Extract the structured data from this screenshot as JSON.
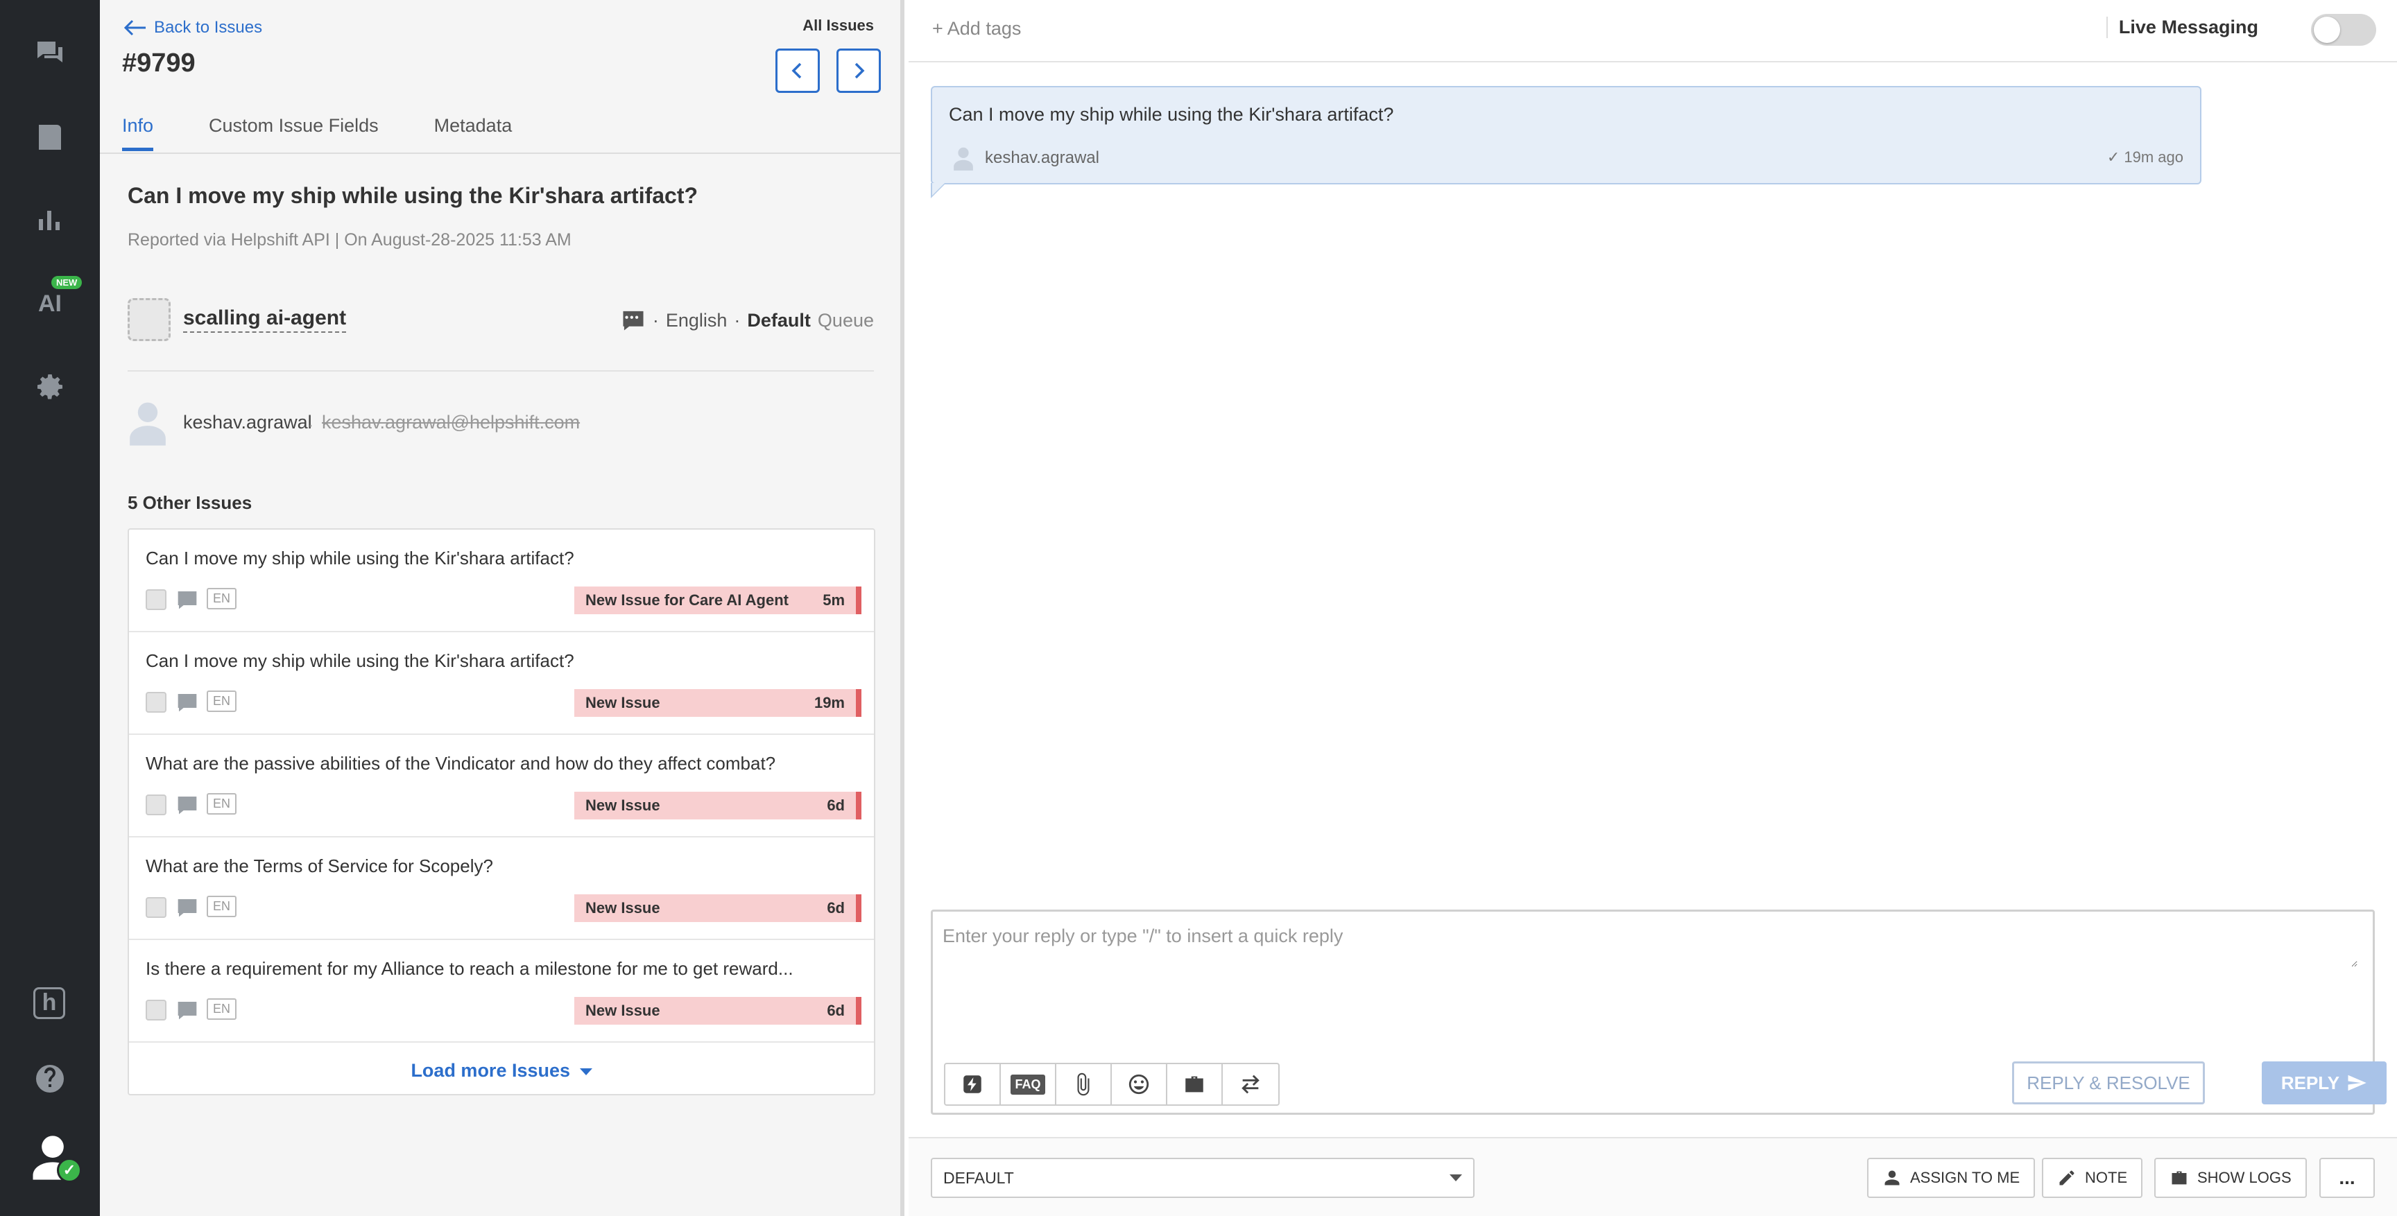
{
  "nav": {
    "ai_label": "AI",
    "new_badge": "NEW",
    "h_label": "h"
  },
  "issue": {
    "back_label": "Back to Issues",
    "all_issues": "All Issues",
    "number": "#9799",
    "tabs": [
      "Info",
      "Custom Issue Fields",
      "Metadata"
    ],
    "subject": "Can I move my ship while using the Kir'shara artifact?",
    "reported": "Reported via Helpshift API | On August-28-2025 11:53 AM",
    "app_name": "scalling ai-agent",
    "language": "English",
    "queue_name": "Default",
    "queue_label": "Queue",
    "user_name": "keshav.agrawal",
    "user_email": "keshav.agrawal@helpshift.com"
  },
  "other_issues": {
    "title": "5 Other Issues",
    "load_more": "Load more Issues",
    "items": [
      {
        "text": "Can I move my ship while using the Kir'shara artifact?",
        "lang": "EN",
        "status": "New Issue for Care AI Agent",
        "age": "5m"
      },
      {
        "text": "Can I move my ship while using the Kir'shara artifact?",
        "lang": "EN",
        "status": "New Issue",
        "age": "19m"
      },
      {
        "text": "What are the passive abilities of the Vindicator and how do they affect combat?",
        "lang": "EN",
        "status": "New Issue",
        "age": "6d"
      },
      {
        "text": "What are the Terms of Service for Scopely?",
        "lang": "EN",
        "status": "New Issue",
        "age": "6d"
      },
      {
        "text": "Is there a requirement for my Alliance to reach a milestone for me to get reward...",
        "lang": "EN",
        "status": "New Issue",
        "age": "6d"
      }
    ]
  },
  "conversation": {
    "add_tags": "+ Add tags",
    "live_messaging": "Live Messaging",
    "message_text": "Can I move my ship while using the Kir'shara artifact?",
    "message_author": "keshav.agrawal",
    "message_time": "✓ 19m ago",
    "reply_placeholder": "Enter your reply or type \"/\" to insert a quick reply",
    "faq_label": "FAQ",
    "reply_resolve": "REPLY & RESOLVE",
    "reply": "REPLY",
    "queue_select": "DEFAULT",
    "assign_to_me": "ASSIGN TO ME",
    "note": "NOTE",
    "show_logs": "SHOW LOGS",
    "more": "..."
  },
  "colors": {
    "accent": "#2c6ecb",
    "rail": "#24272b",
    "status_bg": "#f8cfd0",
    "status_bar": "#e05f62",
    "online": "#3bb54a"
  }
}
